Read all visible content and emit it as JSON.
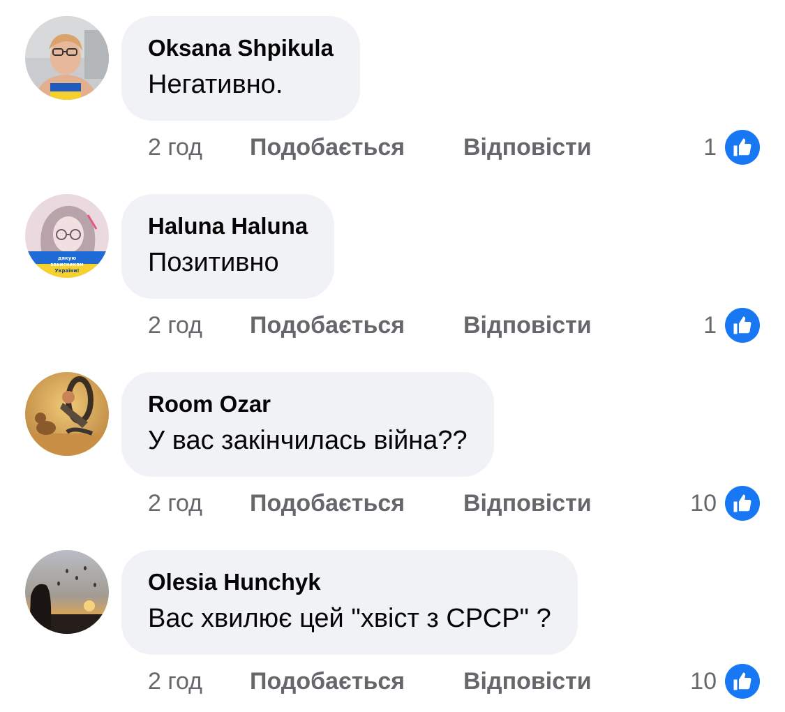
{
  "comments": [
    {
      "author": "Oksana Shpikula",
      "text": "Негативно.",
      "time": "2 год",
      "like_label": "Подобається",
      "reply_label": "Відповісти",
      "reactions": "1",
      "avatar_icon": "profile-photo-woman-glasses"
    },
    {
      "author": "Haluna Haluna",
      "text": "Позитивно",
      "time": "2 год",
      "like_label": "Подобається",
      "reply_label": "Відповісти",
      "reactions": "1",
      "avatar_icon": "profile-photo-illustration-girl",
      "avatar_badge_text": "дякую захисникам України!"
    },
    {
      "author": "Room Ozar",
      "text": "У вас закінчилась війна??",
      "time": "2 год",
      "like_label": "Подобається",
      "reply_label": "Відповісти",
      "reactions": "10",
      "avatar_icon": "profile-photo-boy-with-dog"
    },
    {
      "author": "Olesia Hunchyk",
      "text": "Вас хвилює цей \"хвіст з СРСР\" ?",
      "time": "2 год",
      "like_label": "Подобається",
      "reply_label": "Відповісти",
      "reactions": "10",
      "avatar_icon": "profile-photo-sunset-balloons"
    }
  ],
  "colors": {
    "bubble": "#f0f2f5",
    "text": "#050505",
    "secondary": "#65676b",
    "like_blue": "#1877f2"
  }
}
